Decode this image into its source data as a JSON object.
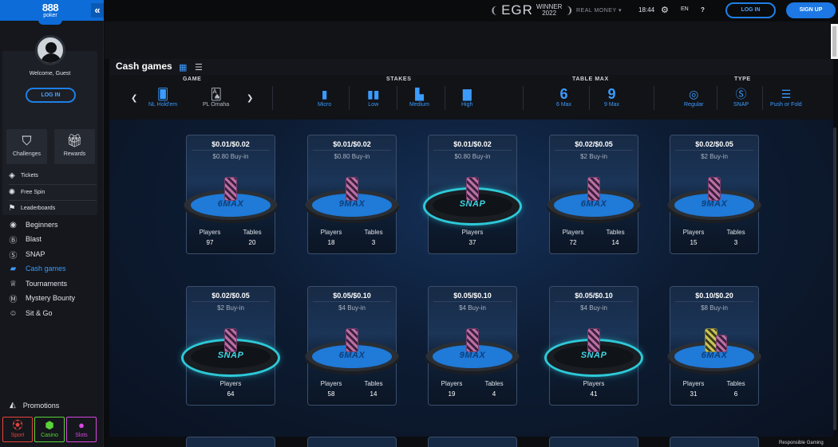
{
  "brand": {
    "logo_top": "888",
    "logo_bottom": "poker",
    "collapse": "«"
  },
  "header": {
    "egr_big": "EGR",
    "egr_small_1": "WINNER",
    "egr_small_2": "2022",
    "real_money": "REAL MONEY",
    "time": "18:44",
    "lang": "EN",
    "help": "?",
    "login": "LOG IN",
    "signup": "SIGN UP"
  },
  "user": {
    "welcome": "Welcome, Guest",
    "login": "LOG IN"
  },
  "tiles": [
    {
      "label": "Challenges",
      "icon": "shield-star-icon"
    },
    {
      "label": "Rewards",
      "icon": "gift-icon"
    }
  ],
  "mini_nav": [
    {
      "label": "Tickets",
      "icon": "ticket-icon"
    },
    {
      "label": "Free Spin",
      "icon": "wheel-icon"
    },
    {
      "label": "Leaderboards",
      "icon": "flag-icon"
    }
  ],
  "nav": [
    {
      "label": "Beginners",
      "icon": "book-icon"
    },
    {
      "label": "Blast",
      "icon": "blast-icon"
    },
    {
      "label": "SNAP",
      "icon": "snap-icon"
    },
    {
      "label": "Cash games",
      "icon": "cards-icon",
      "active": true
    },
    {
      "label": "Tournaments",
      "icon": "trophy-icon"
    },
    {
      "label": "Mystery Bounty",
      "icon": "mystery-icon"
    },
    {
      "label": "Sit & Go",
      "icon": "sitgo-icon"
    }
  ],
  "promotions": "Promotions",
  "bottom_tiles": [
    {
      "label": "Sport",
      "color": "#e8433b"
    },
    {
      "label": "Casino",
      "color": "#59d33a"
    },
    {
      "label": "Slots",
      "color": "#d947e0"
    }
  ],
  "cash": {
    "title": "Cash games"
  },
  "filters": {
    "game_title": "GAME",
    "stakes_title": "STAKES",
    "tablemax_title": "TABLE MAX",
    "type_title": "TYPE",
    "game": [
      "NL Hold'em",
      "PL Omaha"
    ],
    "stakes": [
      "Micro",
      "Low",
      "Medium",
      "High"
    ],
    "tablemax": [
      {
        "num": "6",
        "label": "6 Max"
      },
      {
        "num": "9",
        "label": "9 Max"
      }
    ],
    "type": [
      "Regular",
      "SNAP",
      "Push or Fold"
    ]
  },
  "cards": [
    {
      "stake": "$0.01/$0.02",
      "buyin": "$0.80 Buy-in",
      "table": "6MAX",
      "snap": false,
      "players_label": "Players",
      "players": "97",
      "tables_label": "Tables",
      "tables": "20"
    },
    {
      "stake": "$0.01/$0.02",
      "buyin": "$0.80 Buy-in",
      "table": "9MAX",
      "snap": false,
      "players_label": "Players",
      "players": "18",
      "tables_label": "Tables",
      "tables": "3"
    },
    {
      "stake": "$0.01/$0.02",
      "buyin": "$0.80 Buy-in",
      "table": "SNAP",
      "snap": true,
      "players_label": "Players",
      "players": "37"
    },
    {
      "stake": "$0.02/$0.05",
      "buyin": "$2 Buy-in",
      "table": "6MAX",
      "snap": false,
      "players_label": "Players",
      "players": "72",
      "tables_label": "Tables",
      "tables": "14"
    },
    {
      "stake": "$0.02/$0.05",
      "buyin": "$2 Buy-in",
      "table": "9MAX",
      "snap": false,
      "players_label": "Players",
      "players": "15",
      "tables_label": "Tables",
      "tables": "3"
    },
    {
      "stake": "$0.02/$0.05",
      "buyin": "$2 Buy-in",
      "table": "SNAP",
      "snap": true,
      "players_label": "Players",
      "players": "64"
    },
    {
      "stake": "$0.05/$0.10",
      "buyin": "$4 Buy-in",
      "table": "6MAX",
      "snap": false,
      "players_label": "Players",
      "players": "58",
      "tables_label": "Tables",
      "tables": "14"
    },
    {
      "stake": "$0.05/$0.10",
      "buyin": "$4 Buy-in",
      "table": "9MAX",
      "snap": false,
      "players_label": "Players",
      "players": "19",
      "tables_label": "Tables",
      "tables": "4"
    },
    {
      "stake": "$0.05/$0.10",
      "buyin": "$4 Buy-in",
      "table": "SNAP",
      "snap": true,
      "players_label": "Players",
      "players": "41"
    },
    {
      "stake": "$0.10/$0.20",
      "buyin": "$8 Buy-in",
      "table": "6MAX",
      "snap": false,
      "gold": true,
      "players_label": "Players",
      "players": "31",
      "tables_label": "Tables",
      "tables": "6"
    }
  ],
  "footer": {
    "responsible": "Responsible Gaming"
  }
}
